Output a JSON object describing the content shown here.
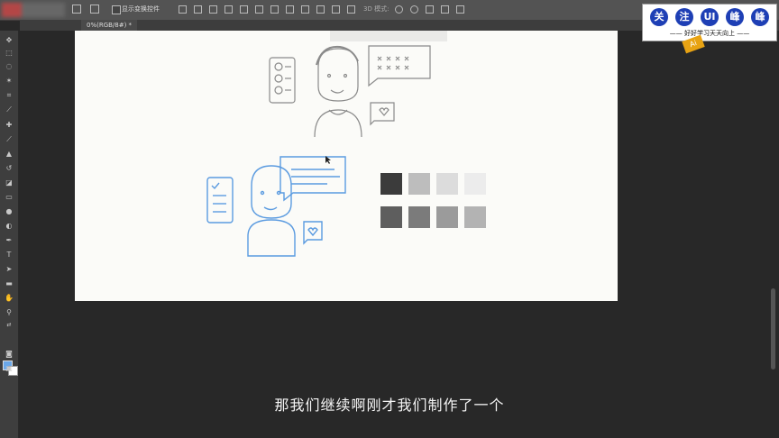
{
  "options_bar": {
    "show_transform_controls": "显示变换控件",
    "mode_3d": "3D 模式:"
  },
  "document_tab": {
    "title": "0%(RGB/8#) *"
  },
  "badge": {
    "chars": [
      "关",
      "注",
      "UI",
      "峰",
      "峰"
    ],
    "tagline": "—— 好好学习天天向上 ——",
    "ai_label": "Ai"
  },
  "subtitle": "那我们继续啊刚才我们制作了一个",
  "colors": {
    "swatches_row1": [
      "#3b3b3b",
      "#bdbdbd",
      "#dcdcdc",
      "#ececec"
    ],
    "swatches_row2": [
      "#5e5e5e",
      "#7b7b7b",
      "#9b9b9b",
      "#b3b3b3"
    ],
    "sketch_blue": "#5b9be0",
    "sketch_gray": "#8a8a8a",
    "foreground": "#6aa7e8"
  },
  "tools": [
    "move-tool",
    "marquee-tool",
    "lasso-tool",
    "magic-wand-tool",
    "crop-tool",
    "eyedropper-tool",
    "healing-tool",
    "brush-tool",
    "stamp-tool",
    "history-brush-tool",
    "eraser-tool",
    "gradient-tool",
    "blur-tool",
    "dodge-tool",
    "pen-tool",
    "type-tool",
    "path-selection-tool",
    "shape-tool",
    "hand-tool",
    "zoom-tool"
  ]
}
